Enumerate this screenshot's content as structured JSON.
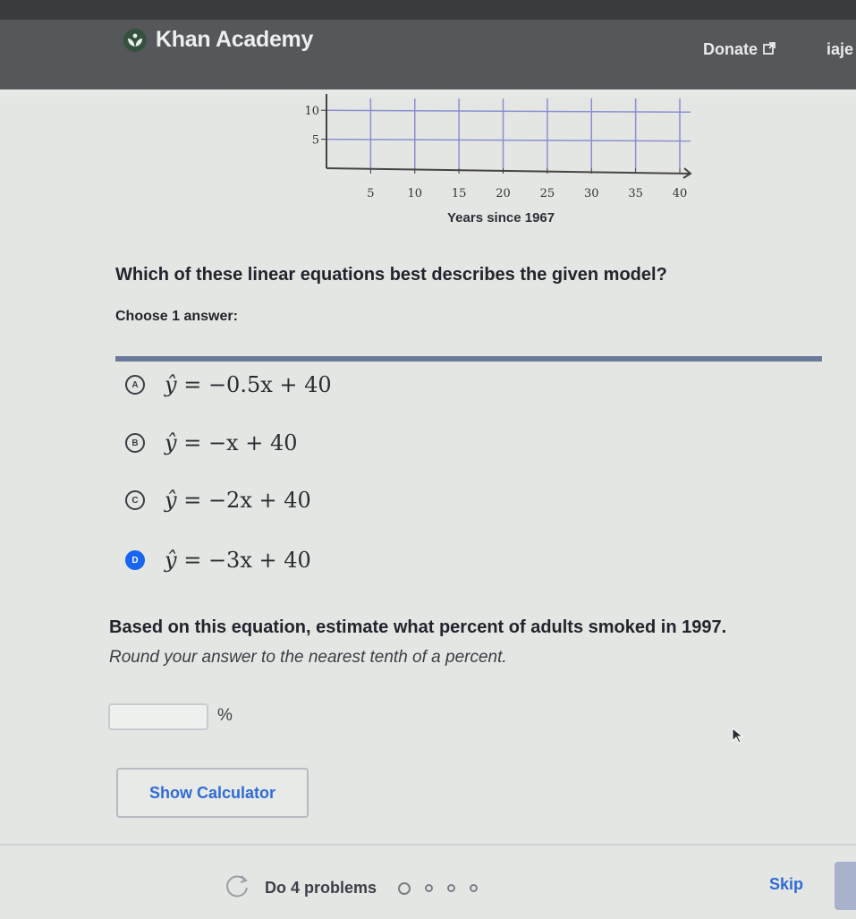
{
  "header": {
    "app_title": "Khan Academy",
    "logo_icon": "khan-academy-leaf-icon",
    "donate_label": "Donate",
    "donate_icon": "external-link-icon",
    "user_name_truncated": "iaje"
  },
  "chart_data": {
    "type": "line",
    "title": "",
    "xlabel": "Years since 1967",
    "ylabel": "",
    "x_ticks": [
      5,
      10,
      15,
      20,
      25,
      30,
      35,
      40
    ],
    "y_ticks_visible": [
      5,
      10
    ],
    "xlim": [
      0,
      40
    ],
    "ylim_visible": [
      0,
      10
    ],
    "grid": true,
    "series": [],
    "note": "Only the lower portion of the graph is visible; no data line shown in visible region"
  },
  "question": {
    "prompt": "Which of these linear equations best describes the given model?",
    "instruction": "Choose 1 answer:",
    "choices": [
      {
        "letter": "A",
        "lhs": "ŷ",
        "rhs": "= −0.5x + 40",
        "selected": false
      },
      {
        "letter": "B",
        "lhs": "ŷ",
        "rhs": "= −x + 40",
        "selected": false
      },
      {
        "letter": "C",
        "lhs": "ŷ",
        "rhs": "= −2x + 40",
        "selected": false
      },
      {
        "letter": "D",
        "lhs": "ŷ",
        "rhs": "= −3x + 40",
        "selected": true
      }
    ]
  },
  "part2": {
    "prompt": "Based on this equation, estimate what percent of adults smoked in 1997.",
    "instruction": "Round your answer to the nearest tenth of a percent.",
    "input_value": "",
    "unit": "%"
  },
  "buttons": {
    "show_calculator": "Show Calculator",
    "skip": "Skip"
  },
  "footer": {
    "progress_label": "Do 4 problems",
    "progress_total": 4,
    "progress_current": 1,
    "reload_icon": "reload-icon"
  },
  "colors": {
    "accent_blue": "#1865f2",
    "link_blue": "#2f6bd6",
    "navbar": "#56575a"
  }
}
